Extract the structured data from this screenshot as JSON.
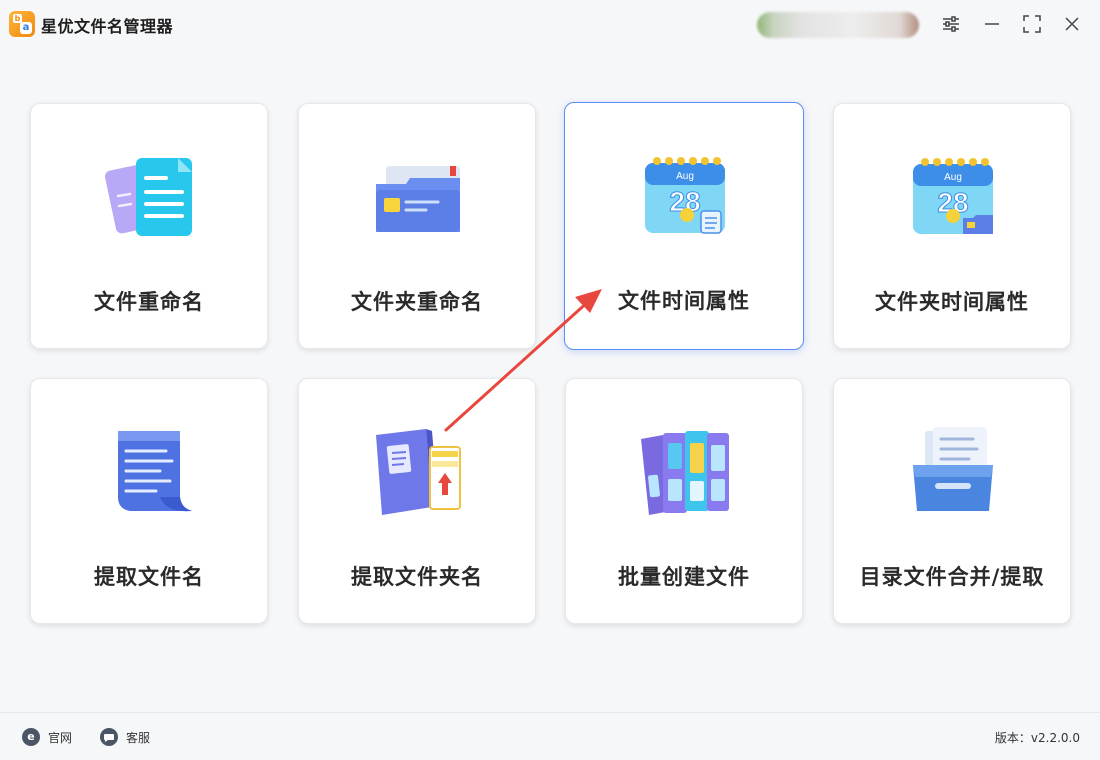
{
  "app": {
    "title": "星优文件名管理器",
    "logo_glyph_top": "b",
    "logo_glyph_bottom": "a"
  },
  "cards": [
    {
      "label": "文件重命名",
      "icon": "file-rename-icon"
    },
    {
      "label": "文件夹重命名",
      "icon": "folder-rename-icon"
    },
    {
      "label": "文件时间属性",
      "icon": "calendar-file-icon",
      "calendar_month": "Aug",
      "calendar_day": "28",
      "selected": true
    },
    {
      "label": "文件夹时间属性",
      "icon": "calendar-folder-icon",
      "calendar_month": "Aug",
      "calendar_day": "28"
    },
    {
      "label": "提取文件名",
      "icon": "extract-filename-icon"
    },
    {
      "label": "提取文件夹名",
      "icon": "extract-foldername-icon"
    },
    {
      "label": "批量创建文件",
      "icon": "batch-create-icon"
    },
    {
      "label": "目录文件合并/提取",
      "icon": "merge-extract-icon"
    }
  ],
  "footer": {
    "website_label": "官网",
    "website_icon_glyph": "e",
    "support_label": "客服",
    "version_text": "版本：v2.2.0.0"
  },
  "colors": {
    "selected_border": "#5b8ff5",
    "annotation_arrow": "#e8473e"
  }
}
